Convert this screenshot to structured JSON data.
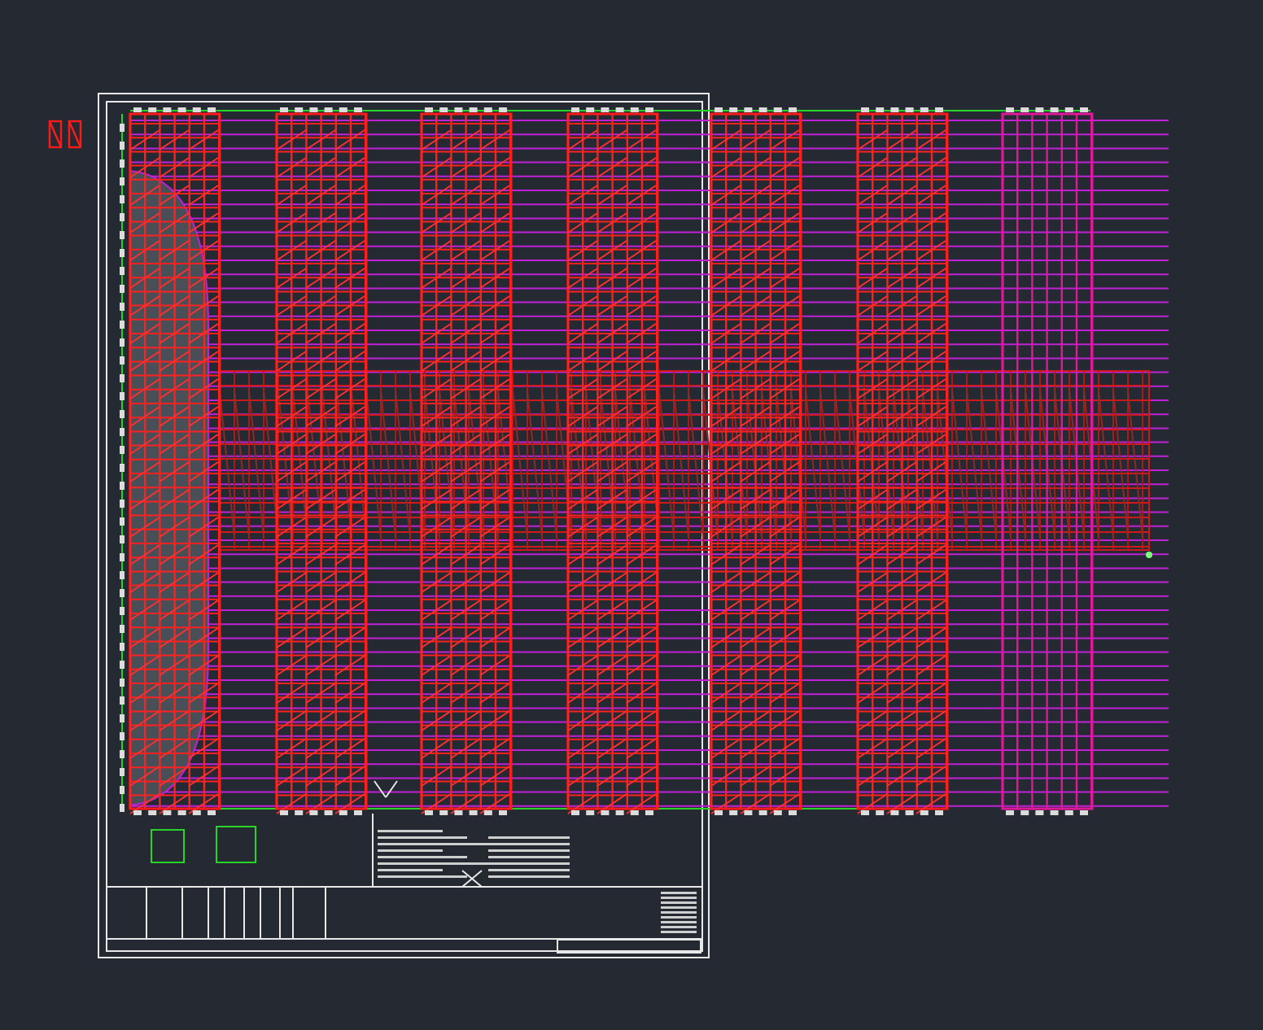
{
  "drawing": {
    "kind": "scaffold-plan"
  }
}
